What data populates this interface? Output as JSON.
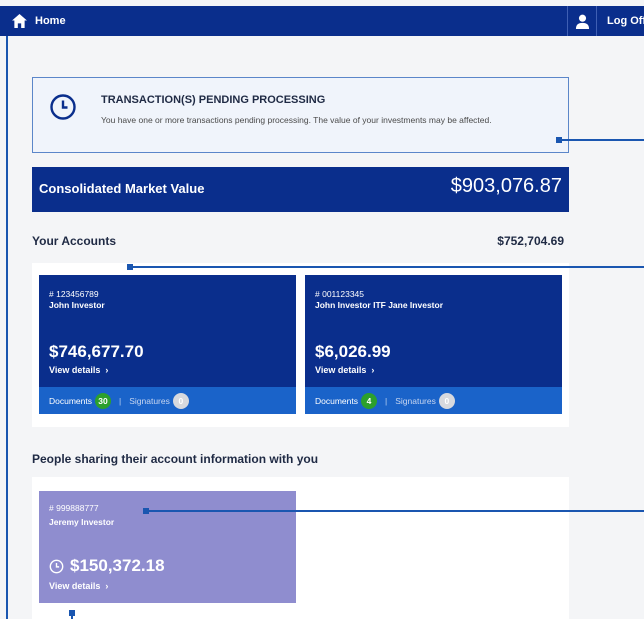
{
  "header": {
    "home_label": "Home",
    "logoff_label": "Log Off"
  },
  "pending": {
    "title": "TRANSACTION(S) PENDING PROCESSING",
    "body": "You have one or more transactions pending processing. The value of your investments may be affected."
  },
  "consolidated": {
    "label": "Consolidated Market Value",
    "value": "$903,076.87"
  },
  "accounts": {
    "title": "Your Accounts",
    "total": "$752,704.69",
    "documents_label": "Documents",
    "signatures_label": "Signatures",
    "view_details_label": "View details",
    "items": [
      {
        "number": "# 123456789",
        "owner": "John Investor",
        "balance": "$746,677.70",
        "documents_count": "30",
        "signatures_count": "0"
      },
      {
        "number": "# 001123345",
        "owner": "John Investor ITF Jane Investor",
        "balance": "$6,026.99",
        "documents_count": "4",
        "signatures_count": "0"
      }
    ]
  },
  "shared": {
    "title": "People sharing their account information with you",
    "items": [
      {
        "number": "# 999888777",
        "owner": "Jeremy Investor",
        "balance": "$150,372.18",
        "view_details_label": "View details"
      }
    ]
  },
  "colors": {
    "brand_navy": "#0a2e8c",
    "card_footer_blue": "#1a63c9",
    "shared_card_purple": "#8f8dcf",
    "badge_green": "#2ca02c"
  }
}
